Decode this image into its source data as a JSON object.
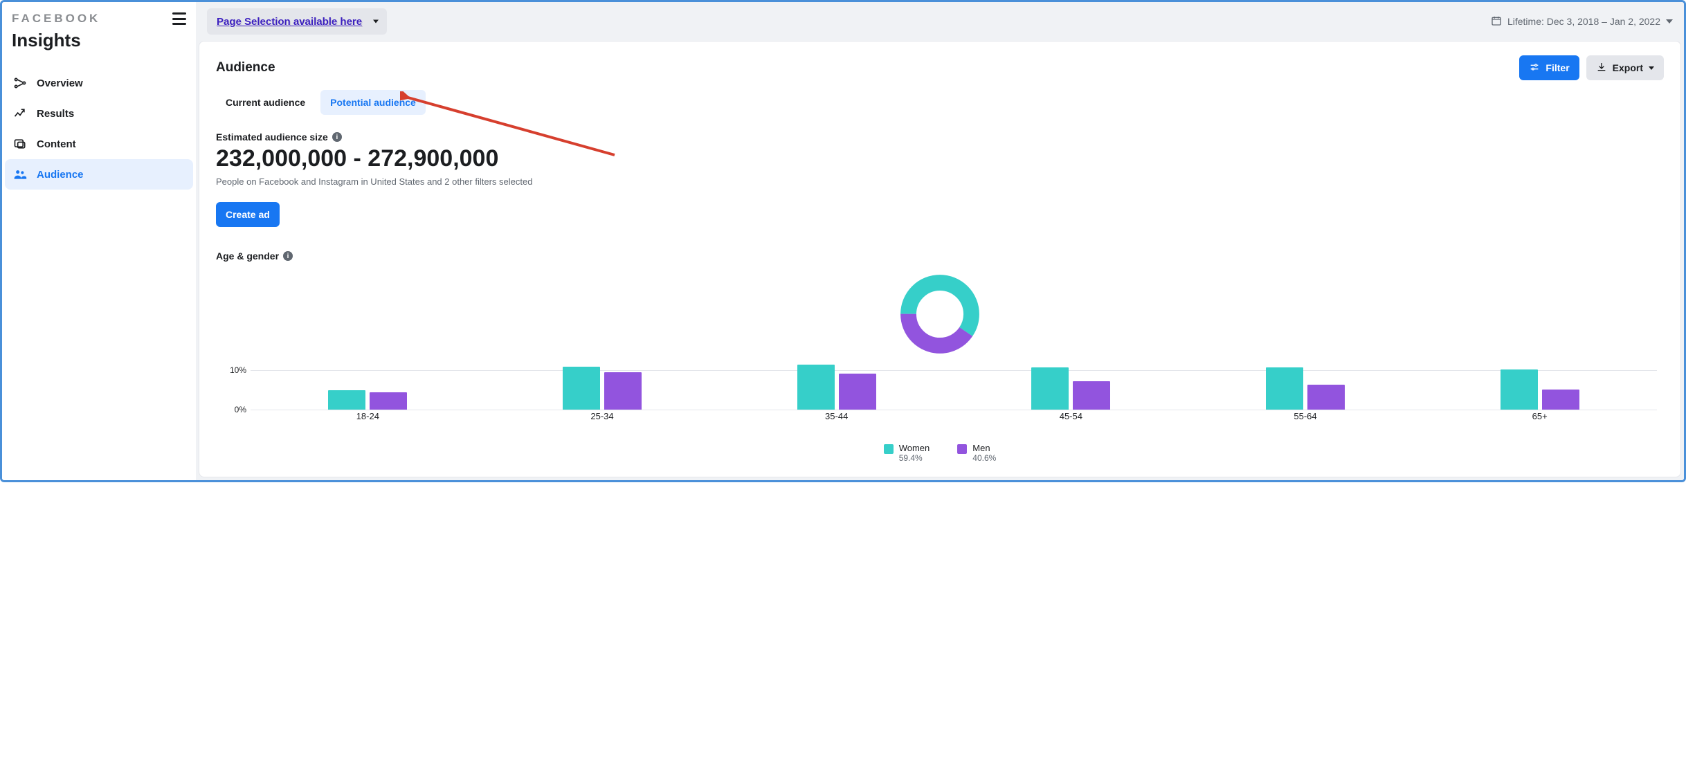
{
  "brand": "FACEBOOK",
  "app_title": "Insights",
  "sidebar": {
    "items": [
      {
        "key": "overview",
        "label": "Overview"
      },
      {
        "key": "results",
        "label": "Results"
      },
      {
        "key": "content",
        "label": "Content"
      },
      {
        "key": "audience",
        "label": "Audience"
      }
    ],
    "active_key": "audience"
  },
  "topbar": {
    "page_selector_label": "Page Selection available here",
    "date_range_label": "Lifetime: Dec 3, 2018 – Jan 2, 2022"
  },
  "header": {
    "title": "Audience",
    "filter_label": "Filter",
    "export_label": "Export"
  },
  "tabs": {
    "current": "Current audience",
    "potential": "Potential audience",
    "active_key": "potential"
  },
  "estimated": {
    "label": "Estimated audience size",
    "value": "232,000,000 - 272,900,000",
    "subtext": "People on Facebook and Instagram in United States and 2 other filters selected",
    "create_ad_label": "Create ad"
  },
  "age_gender": {
    "label": "Age & gender"
  },
  "legend": {
    "women_label": "Women",
    "women_pct": "59.4%",
    "men_label": "Men",
    "men_pct": "40.6%"
  },
  "chart_data": [
    {
      "type": "pie",
      "title": "Gender split",
      "series": [
        {
          "name": "Women",
          "value": 59.4,
          "color": "#36cfc9"
        },
        {
          "name": "Men",
          "value": 40.6,
          "color": "#9254de"
        }
      ]
    },
    {
      "type": "bar",
      "title": "Age & gender",
      "xlabel": "",
      "ylabel": "",
      "ylim": [
        0,
        12
      ],
      "y_ticks": [
        0,
        10
      ],
      "categories": [
        "18-24",
        "25-34",
        "35-44",
        "45-54",
        "55-64",
        "65+"
      ],
      "series": [
        {
          "name": "Women",
          "color": "#36cfc9",
          "values": [
            5.0,
            11.0,
            11.5,
            10.8,
            10.8,
            10.2
          ]
        },
        {
          "name": "Men",
          "color": "#9254de",
          "values": [
            4.4,
            9.6,
            9.2,
            7.2,
            6.4,
            5.2
          ]
        }
      ]
    }
  ]
}
